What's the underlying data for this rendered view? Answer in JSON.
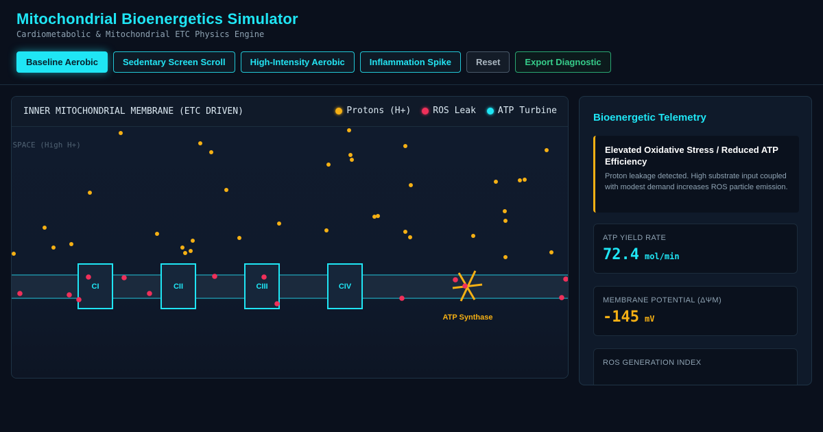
{
  "header": {
    "title": "Mitochondrial Bioenergetics Simulator",
    "subtitle": "Cardiometabolic & Mitochondrial ETC Physics Engine"
  },
  "toolbar": {
    "buttons": [
      {
        "label": "Baseline Aerobic",
        "state": "active"
      },
      {
        "label": "Sedentary Screen Scroll"
      },
      {
        "label": "High-Intensity Aerobic"
      },
      {
        "label": "Inflammation Spike"
      },
      {
        "label": "Reset"
      },
      {
        "label": "Export Diagnostic"
      }
    ]
  },
  "simulation": {
    "title": "INNER MITOCHONDRIAL MEMBRANE (ETC DRIVEN)",
    "legend": [
      {
        "label": "Protons (H+)",
        "color": "#f5b014"
      },
      {
        "label": "ROS Leak",
        "color": "#f0305a"
      },
      {
        "label": "ATP Turbine",
        "color": "#1fe6f5"
      }
    ],
    "space_label": "IMS SPACE (High H+)",
    "complexes": [
      "CI",
      "CII",
      "CIII",
      "CIV"
    ],
    "synthase_label": "ATP Synthase"
  },
  "telemetry": {
    "title": "Bioenergetic Telemetry",
    "alert": {
      "title": "Elevated Oxidative Stress / Reduced ATP Efficiency",
      "body": "Proton leakage detected. High substrate input coupled with modest demand increases ROS particle emission."
    },
    "metrics": [
      {
        "label": "ATP YIELD RATE",
        "value": "72.4",
        "unit": "mol/min",
        "color": "#1fe6f5"
      },
      {
        "label": "MEMBRANE POTENTIAL (ΔΨM)",
        "value": "-145",
        "unit": "mV",
        "color": "#f5b014"
      },
      {
        "label": "ROS GENERATION INDEX",
        "value": "",
        "unit": ""
      }
    ]
  }
}
